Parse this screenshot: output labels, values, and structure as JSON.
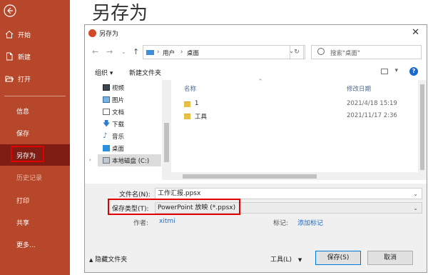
{
  "sidebar": {
    "items": [
      {
        "label": "开始"
      },
      {
        "label": "新建"
      },
      {
        "label": "打开"
      },
      {
        "label": "信息"
      },
      {
        "label": "保存"
      },
      {
        "label": "另存为"
      },
      {
        "label": "历史记录"
      },
      {
        "label": "打印"
      },
      {
        "label": "共享"
      },
      {
        "label": "更多..."
      }
    ],
    "bg_color": "#b7472a",
    "active_color": "#7f1d14"
  },
  "page": {
    "title": "另存为"
  },
  "dialog": {
    "title": "另存为",
    "breadcrumb": [
      "用户",
      "桌面"
    ],
    "search_placeholder": "搜索\"桌面\"",
    "toolbar": {
      "organize": "组织 ▾",
      "new_folder": "新建文件夹"
    },
    "nav": [
      {
        "label": "视频",
        "icon": "video-icon"
      },
      {
        "label": "图片",
        "icon": "picture-icon"
      },
      {
        "label": "文档",
        "icon": "document-icon"
      },
      {
        "label": "下载",
        "icon": "download-icon"
      },
      {
        "label": "音乐",
        "icon": "music-icon"
      },
      {
        "label": "桌面",
        "icon": "desktop-icon"
      },
      {
        "label": "本地磁盘 (C:)",
        "icon": "disk-icon"
      }
    ],
    "columns": {
      "name": "名称",
      "date": "修改日期"
    },
    "files": [
      {
        "name": "1",
        "date": "2021/4/18 15:19"
      },
      {
        "name": "工具",
        "date": "2021/11/17 2:36"
      }
    ],
    "form": {
      "filename_label": "文件名(N):",
      "filename_value": "工作汇报.ppsx",
      "type_label": "保存类型(T):",
      "type_value": "PowerPoint 放映 (*.ppsx)",
      "author_label": "作者:",
      "author_value": "xitmi",
      "tags_label": "标记:",
      "tags_value": "添加标记"
    },
    "footer": {
      "hide_folders": "隐藏文件夹",
      "tools": "工具(L)",
      "save": "保存(S)",
      "cancel": "取消"
    }
  },
  "colors": {
    "highlight": "#e00000",
    "link": "#1b6ac9"
  }
}
